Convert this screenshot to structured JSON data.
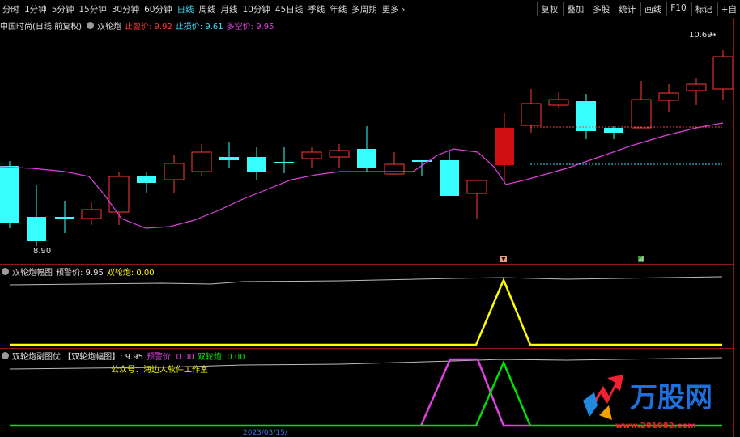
{
  "toolbar": {
    "periods": [
      "分时",
      "1分钟",
      "5分钟",
      "15分钟",
      "30分钟",
      "60分钟",
      "日线",
      "周线",
      "月线",
      "10分钟",
      "45日线",
      "季线",
      "年线",
      "多周期",
      "更多 ›"
    ],
    "active_period": "日线",
    "right_buttons": [
      "复权",
      "叠加",
      "多股",
      "统计",
      "画线",
      "F10",
      "标记",
      "+自"
    ]
  },
  "main_panel": {
    "title": "中国时尚(日线 前复权)",
    "indicator": "双轮炮",
    "stop_profit": "止盈价: 9.92",
    "stop_loss": "止损价: 9.61",
    "bull_bear": "多空价: 9.95",
    "high_label": "10.69",
    "low_label": "8.90",
    "marker_up": "▼",
    "marker_reduce": "减"
  },
  "panel2": {
    "gear_title": "双轮炮幅图",
    "warn": "预警价: 9.95",
    "signal": "双轮炮: 0.00"
  },
  "panel3": {
    "title": "双轮炮副图优 【双轮炮幅图】: 9.95",
    "warn": "预警价: 0.00",
    "signal": "双轮炮: 0.00",
    "note": "公众号：海边人软件工作室",
    "date": "2023/03/15/"
  },
  "watermark": {
    "text": "万股网",
    "url": "www.201082.com"
  },
  "colors": {
    "up": "#ff3a3a",
    "down": "#38ffff",
    "ma": "#e040e0",
    "yellow": "#ffff00",
    "green": "#00e000",
    "magenta": "#e040e0"
  }
}
